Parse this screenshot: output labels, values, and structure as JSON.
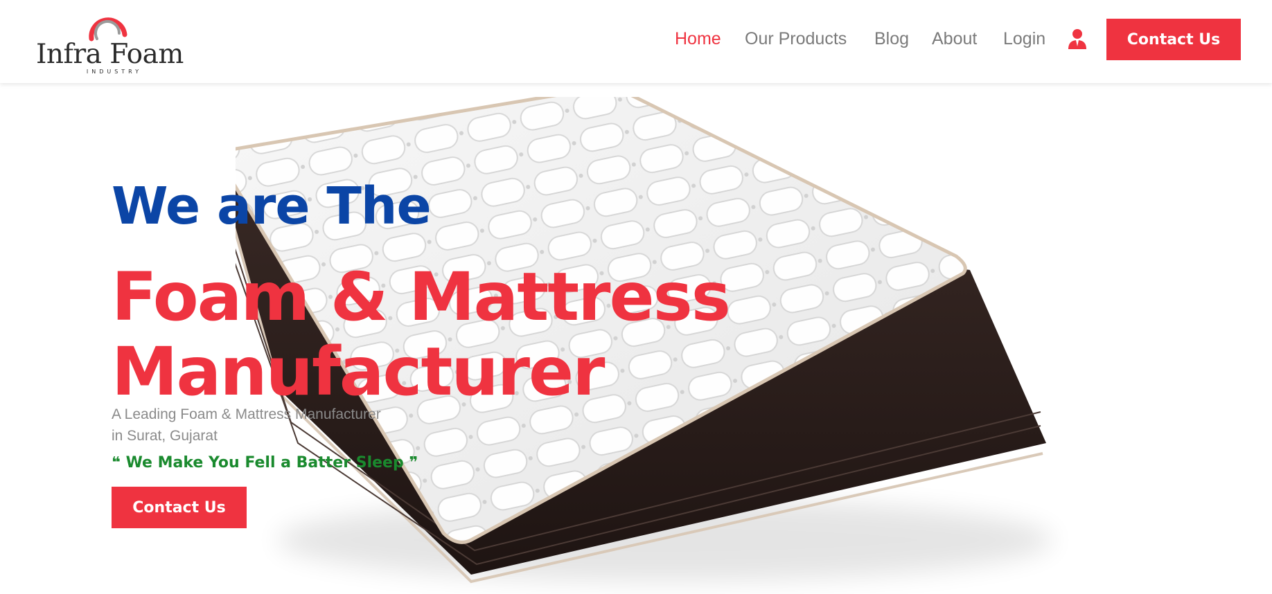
{
  "brand": {
    "name": "Infra Foam",
    "subtitle": "INDUSTRY",
    "colors": {
      "primary_red": "#ef3340",
      "logo_gray": "#9a9a9a",
      "text_dark": "#2b2b2b"
    }
  },
  "nav": {
    "items": [
      {
        "label": "Home",
        "active": true
      },
      {
        "label": "Our Products",
        "active": false
      },
      {
        "label": "Blog",
        "active": false
      },
      {
        "label": "About",
        "active": false
      },
      {
        "label": "Login",
        "active": false
      }
    ],
    "user_icon": "user-account-icon",
    "cta_label": "Contact Us"
  },
  "hero": {
    "eyebrow": "We are The",
    "headline_line1": "Foam & Mattress",
    "headline_line2": "Manufacturer",
    "subtitle_line1": "A Leading Foam & Mattress Manufacturer",
    "subtitle_line2": "in Surat, Gujarat",
    "quote": "❝ We Make You Fell a Batter Sleep ❞",
    "cta_label": "Contact Us",
    "image": "mattress-image",
    "colors": {
      "eyebrow": "#0b45a6",
      "headline": "#ef3340",
      "quote": "#1a8a2e",
      "subtitle": "#8a8a8a"
    }
  }
}
